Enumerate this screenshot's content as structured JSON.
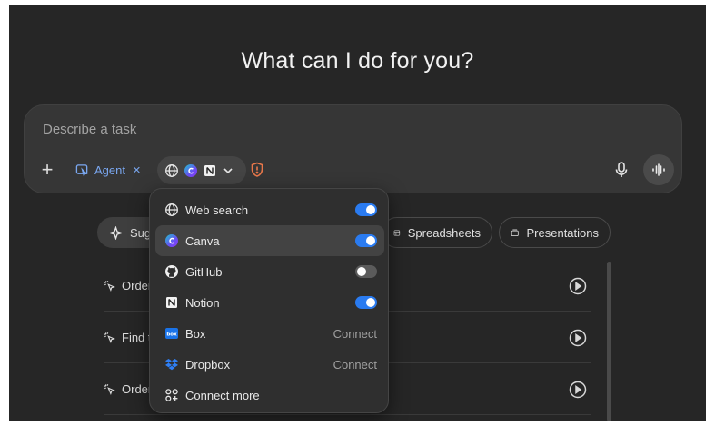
{
  "title": "What can I do for you?",
  "composer": {
    "placeholder": "Describe a task",
    "agent_label": "Agent",
    "agent_remove": "×"
  },
  "chips": [
    {
      "label": "Sug",
      "icon": "sparkle-icon"
    },
    {
      "label": "Spreadsheets",
      "icon": "table-icon"
    },
    {
      "label": "Presentations",
      "icon": "presentation-icon"
    }
  ],
  "suggestions": [
    {
      "label": "Order"
    },
    {
      "label": "Find t"
    },
    {
      "label": "Order"
    }
  ],
  "menu": {
    "items": [
      {
        "label": "Web search",
        "icon": "globe-icon",
        "toggle": true
      },
      {
        "label": "Canva",
        "icon": "canva-icon",
        "toggle": true
      },
      {
        "label": "GitHub",
        "icon": "github-icon",
        "toggle": false
      },
      {
        "label": "Notion",
        "icon": "notion-icon",
        "toggle": true
      },
      {
        "label": "Box",
        "icon": "box-icon",
        "action": "Connect"
      },
      {
        "label": "Dropbox",
        "icon": "dropbox-icon",
        "action": "Connect"
      },
      {
        "label": "Connect more",
        "icon": "apps-icon"
      }
    ]
  },
  "colors": {
    "accent": "#2a7bf0",
    "agent": "#7aa7f0",
    "warning": "#e8774a",
    "background": "#262626"
  }
}
